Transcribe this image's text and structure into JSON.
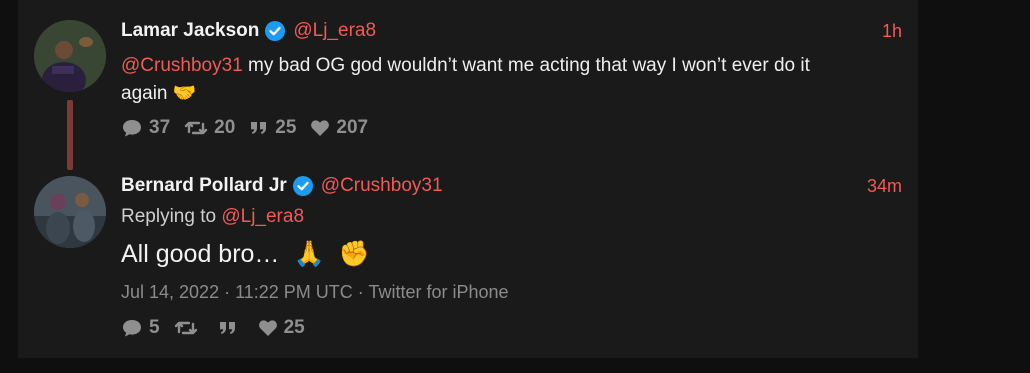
{
  "tweets": [
    {
      "name": "Lamar Jackson",
      "handle": "@Lj_era8",
      "time": "1h",
      "mention": "@Crushboy31",
      "text_line1": " my bad OG god wouldn’t want me acting that way I won’t ever do it",
      "text_line2": "again",
      "emoji": "🤝",
      "stats": {
        "replies": "37",
        "retweets": "20",
        "quotes": "25",
        "likes": "207"
      }
    },
    {
      "name": "Bernard Pollard Jr",
      "handle": "@Crushboy31",
      "time": "34m",
      "replying_label": "Replying to",
      "replying_to": "@Lj_era8",
      "text": "All good bro…",
      "emoji1": "🙏",
      "emoji2": "✊",
      "meta": "Jul 14, 2022 · 11:22 PM UTC · Twitter for iPhone",
      "stats": {
        "replies": "5",
        "retweets": "",
        "quotes": "",
        "likes": "25"
      }
    }
  ],
  "colors": {
    "accent": "#f05a57",
    "verified": "#1d9bf0",
    "thread_line": "#7a3a38"
  },
  "icons": [
    "verified-badge-icon",
    "comment-icon",
    "retweet-icon",
    "quote-icon",
    "heart-icon"
  ]
}
